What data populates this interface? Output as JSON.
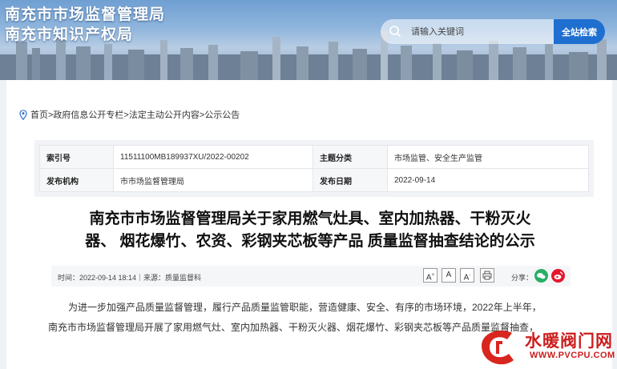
{
  "header": {
    "title_line1": "南充市市场监督管理局",
    "title_line2": "南充市知识产权局",
    "search_placeholder": "请输入关键词",
    "search_button": "全站检索"
  },
  "breadcrumb": "首页>政府信息公开专栏>法定主动公开内容>公示公告",
  "meta": {
    "index_label": "索引号",
    "index_value": "11511100MB189937XU/2022-00202",
    "topic_label": "主题分类",
    "topic_value": "市场监管、安全生产监管",
    "publisher_label": "发布机构",
    "publisher_value": "市市场监督管理局",
    "date_label": "发布日期",
    "date_value": "2022-09-14"
  },
  "article": {
    "title_line1": "南充市市场监督管理局关于家用燃气灶具、室内加热器、干粉灭火",
    "title_line2": "器、 烟花爆竹、农资、彩钢夹芯板等产品 质量监督抽查结论的公示",
    "info_text": "时间：2022-09-14 18:14｜来源：质量监督科",
    "font_increase": "A",
    "font_normal": "A",
    "font_decrease": "A",
    "share_label": "分享：",
    "para1": "为进一步加强产品质量监督管理，履行产品质量监管职能，营造健康、安全、有序的市场环境，2022年上半年，",
    "para2": "南充市市场监督管理局开展了家用燃气灶、室内加热器、干粉灭火器、烟花爆竹、彩钢夹芯板等产品质量监督抽查，"
  },
  "watermark": {
    "brand": "水暖阀门网",
    "url": "WWW.PVCPU.COM"
  },
  "colors": {
    "accent": "#1e6fd0",
    "wechat": "#2aae67",
    "weibo": "#e6162d",
    "watermark": "#cc1d1d"
  }
}
